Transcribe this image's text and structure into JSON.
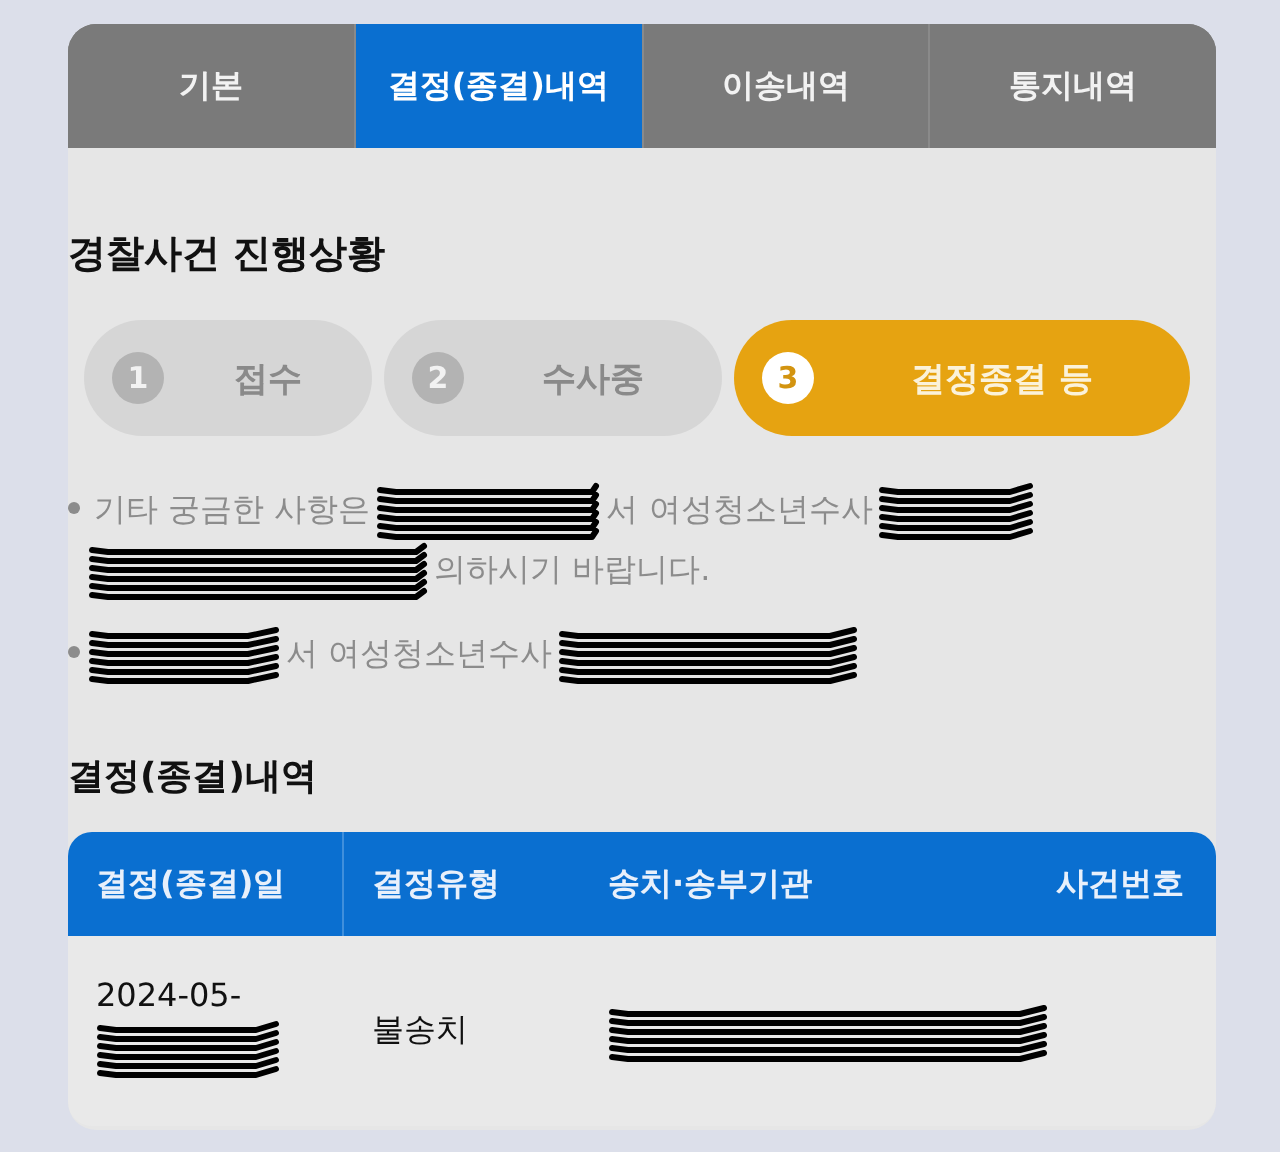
{
  "tabs": [
    {
      "label": "기본",
      "selected": false
    },
    {
      "label": "결정(종결)내역",
      "selected": true
    },
    {
      "label": "이송내역",
      "selected": false
    },
    {
      "label": "통지내역",
      "selected": false
    }
  ],
  "progress": {
    "title": "경찰사건 진행상황",
    "steps": [
      {
        "number": "1",
        "label": "접수",
        "selected": false
      },
      {
        "number": "2",
        "label": "수사중",
        "selected": false
      },
      {
        "number": "3",
        "label": "결정종결 등",
        "selected": true
      }
    ]
  },
  "notes": [
    {
      "lines": [
        [
          {
            "kind": "text",
            "text": "기타 궁금한 사항은"
          },
          {
            "kind": "redacted"
          },
          {
            "kind": "text",
            "text": "서 여성청소년수사"
          },
          {
            "kind": "redacted"
          }
        ],
        [
          {
            "kind": "redacted"
          },
          {
            "kind": "text",
            "text": "의하시기 바랍니다."
          }
        ]
      ]
    },
    {
      "lines": [
        [
          {
            "kind": "redacted"
          },
          {
            "kind": "text",
            "text": "서 여성청소년수사"
          },
          {
            "kind": "redacted"
          }
        ]
      ]
    }
  ],
  "results": {
    "title": "결정(종결)내역",
    "columns": [
      "결정(종결)일",
      "결정유형",
      "송치·송부기관",
      "사건번호"
    ],
    "rows": [
      [
        [
          {
            "kind": "text",
            "text": "2024-05-"
          },
          {
            "kind": "redacted"
          }
        ],
        [
          {
            "kind": "text",
            "text": "불송치"
          }
        ],
        [
          {
            "kind": "redacted"
          }
        ]
      ]
    ]
  }
}
